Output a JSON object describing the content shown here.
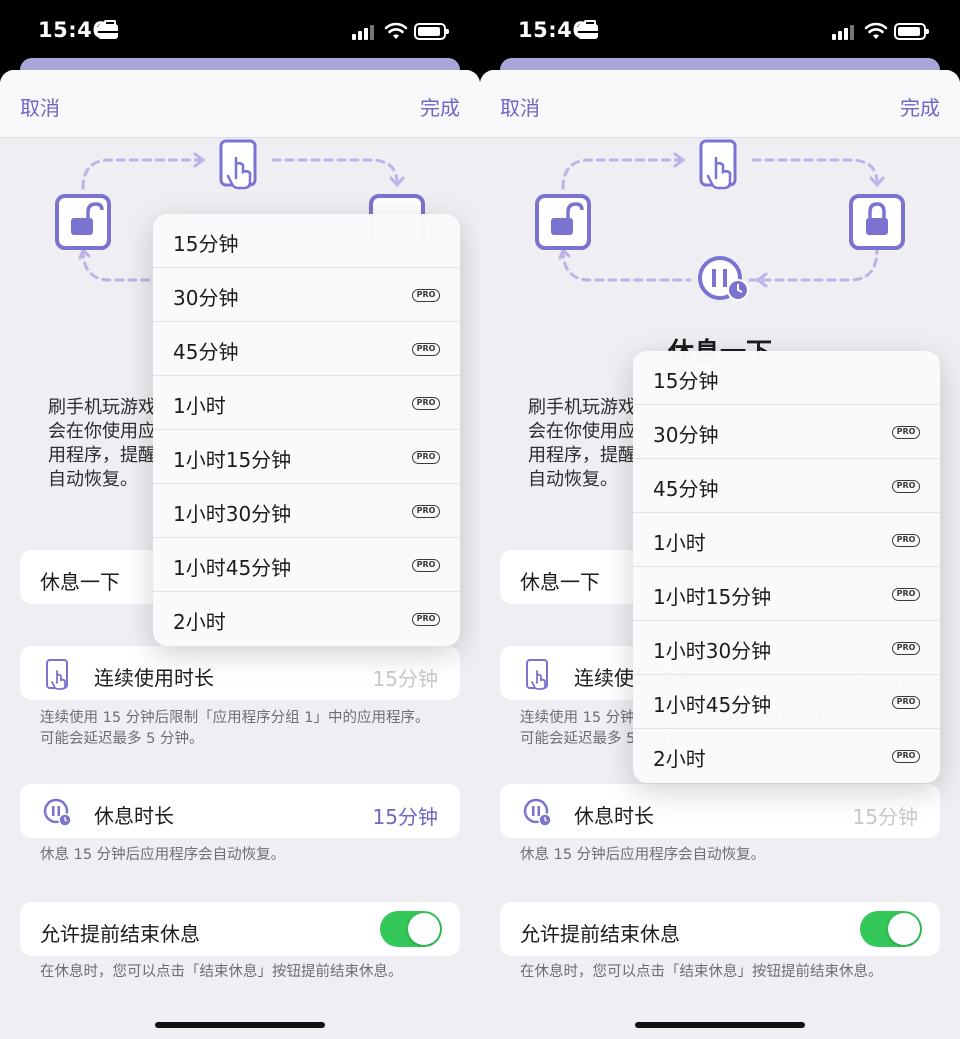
{
  "status_bar": {
    "time": "15:46"
  },
  "nav": {
    "cancel": "取消",
    "done": "完成"
  },
  "hero": {
    "title": "休息一下"
  },
  "description": "刷手机玩游戏\n会在你使用应\n用程序，提醒\n自动恢复。",
  "rest_row": {
    "label": "休息一下"
  },
  "continuous_row": {
    "label": "连续使用时长",
    "value": "15分钟",
    "footnote": "连续使用 15 分钟后限制「应用程序分组 1」中的应用程序。可能会延迟最多 5 分钟。"
  },
  "break_row": {
    "label": "休息时长",
    "value": "15分钟",
    "footnote": "休息 15 分钟后应用程序会自动恢复。"
  },
  "allow_row": {
    "label": "允许提前结束休息",
    "toggle_on": true,
    "footnote": "在休息时，您可以点击「结束休息」按钮提前结束休息。"
  },
  "menu": {
    "pro_badge": "PRO",
    "options": [
      {
        "label": "15分钟",
        "pro": false
      },
      {
        "label": "30分钟",
        "pro": true
      },
      {
        "label": "45分钟",
        "pro": true
      },
      {
        "label": "1小时",
        "pro": true
      },
      {
        "label": "1小时15分钟",
        "pro": true
      },
      {
        "label": "1小时30分钟",
        "pro": true
      },
      {
        "label": "1小时45分钟",
        "pro": true
      },
      {
        "label": "2小时",
        "pro": true
      }
    ]
  },
  "colors": {
    "accent": "#6d67c4",
    "toggle_on": "#34c759",
    "icon_purple": "#7b73d1"
  },
  "icons": [
    "case-icon",
    "signal-icon",
    "wifi-icon",
    "battery-icon",
    "phone-tap-icon",
    "unlock-icon",
    "lock-icon",
    "pause-timer-icon",
    "toggle"
  ]
}
